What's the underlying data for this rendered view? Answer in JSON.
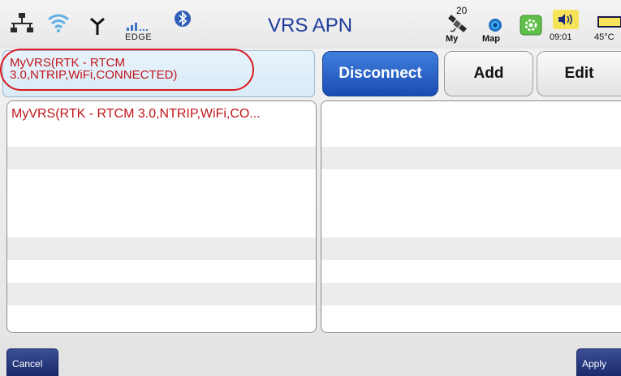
{
  "status": {
    "title": "VRS APN",
    "cell_network": "EDGE",
    "cell_signal_text": "ıl...",
    "satellite_count": "20",
    "satellite_label": "My",
    "map_label": "Map",
    "time": "09:01",
    "temperature": "45°C",
    "icons": [
      "ethernet-icon",
      "wifi-icon",
      "antenna-icon",
      "cell-signal-icon",
      "bluetooth-icon",
      "satellite-icon",
      "map-icon",
      "gear-icon",
      "volume-icon",
      "battery-icon"
    ]
  },
  "current_apn": {
    "line1": "MyVRS(RTK - RTCM",
    "line2": "3.0,NTRIP,WiFi,CONNECTED)"
  },
  "buttons": {
    "disconnect": "Disconnect",
    "add": "Add",
    "edit": "Edit"
  },
  "lists": {
    "left_items": [
      "MyVRS(RTK - RTCM 3.0,NTRIP,WiFi,CO..."
    ],
    "right_items": []
  },
  "softkeys": {
    "cancel": "Cancel",
    "apply": "Apply"
  },
  "colors": {
    "accent_blue": "#1b4cb4",
    "title_blue": "#1f3c9c",
    "connected_red": "#c0141a",
    "highlight_red": "#d8191f"
  }
}
